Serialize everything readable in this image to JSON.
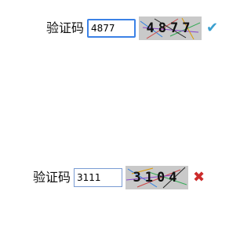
{
  "colors": {
    "ok": "#3a9fcf",
    "error": "#cc2b2b"
  },
  "rows": [
    {
      "label": "验证码",
      "input_value": "4877",
      "captcha_code": "4877",
      "status_icon": "check-icon",
      "status_glyph": "✔"
    },
    {
      "label": "验证码",
      "input_value": "3111",
      "captcha_code": "3104",
      "status_icon": "cross-icon",
      "status_glyph": "✖"
    }
  ]
}
